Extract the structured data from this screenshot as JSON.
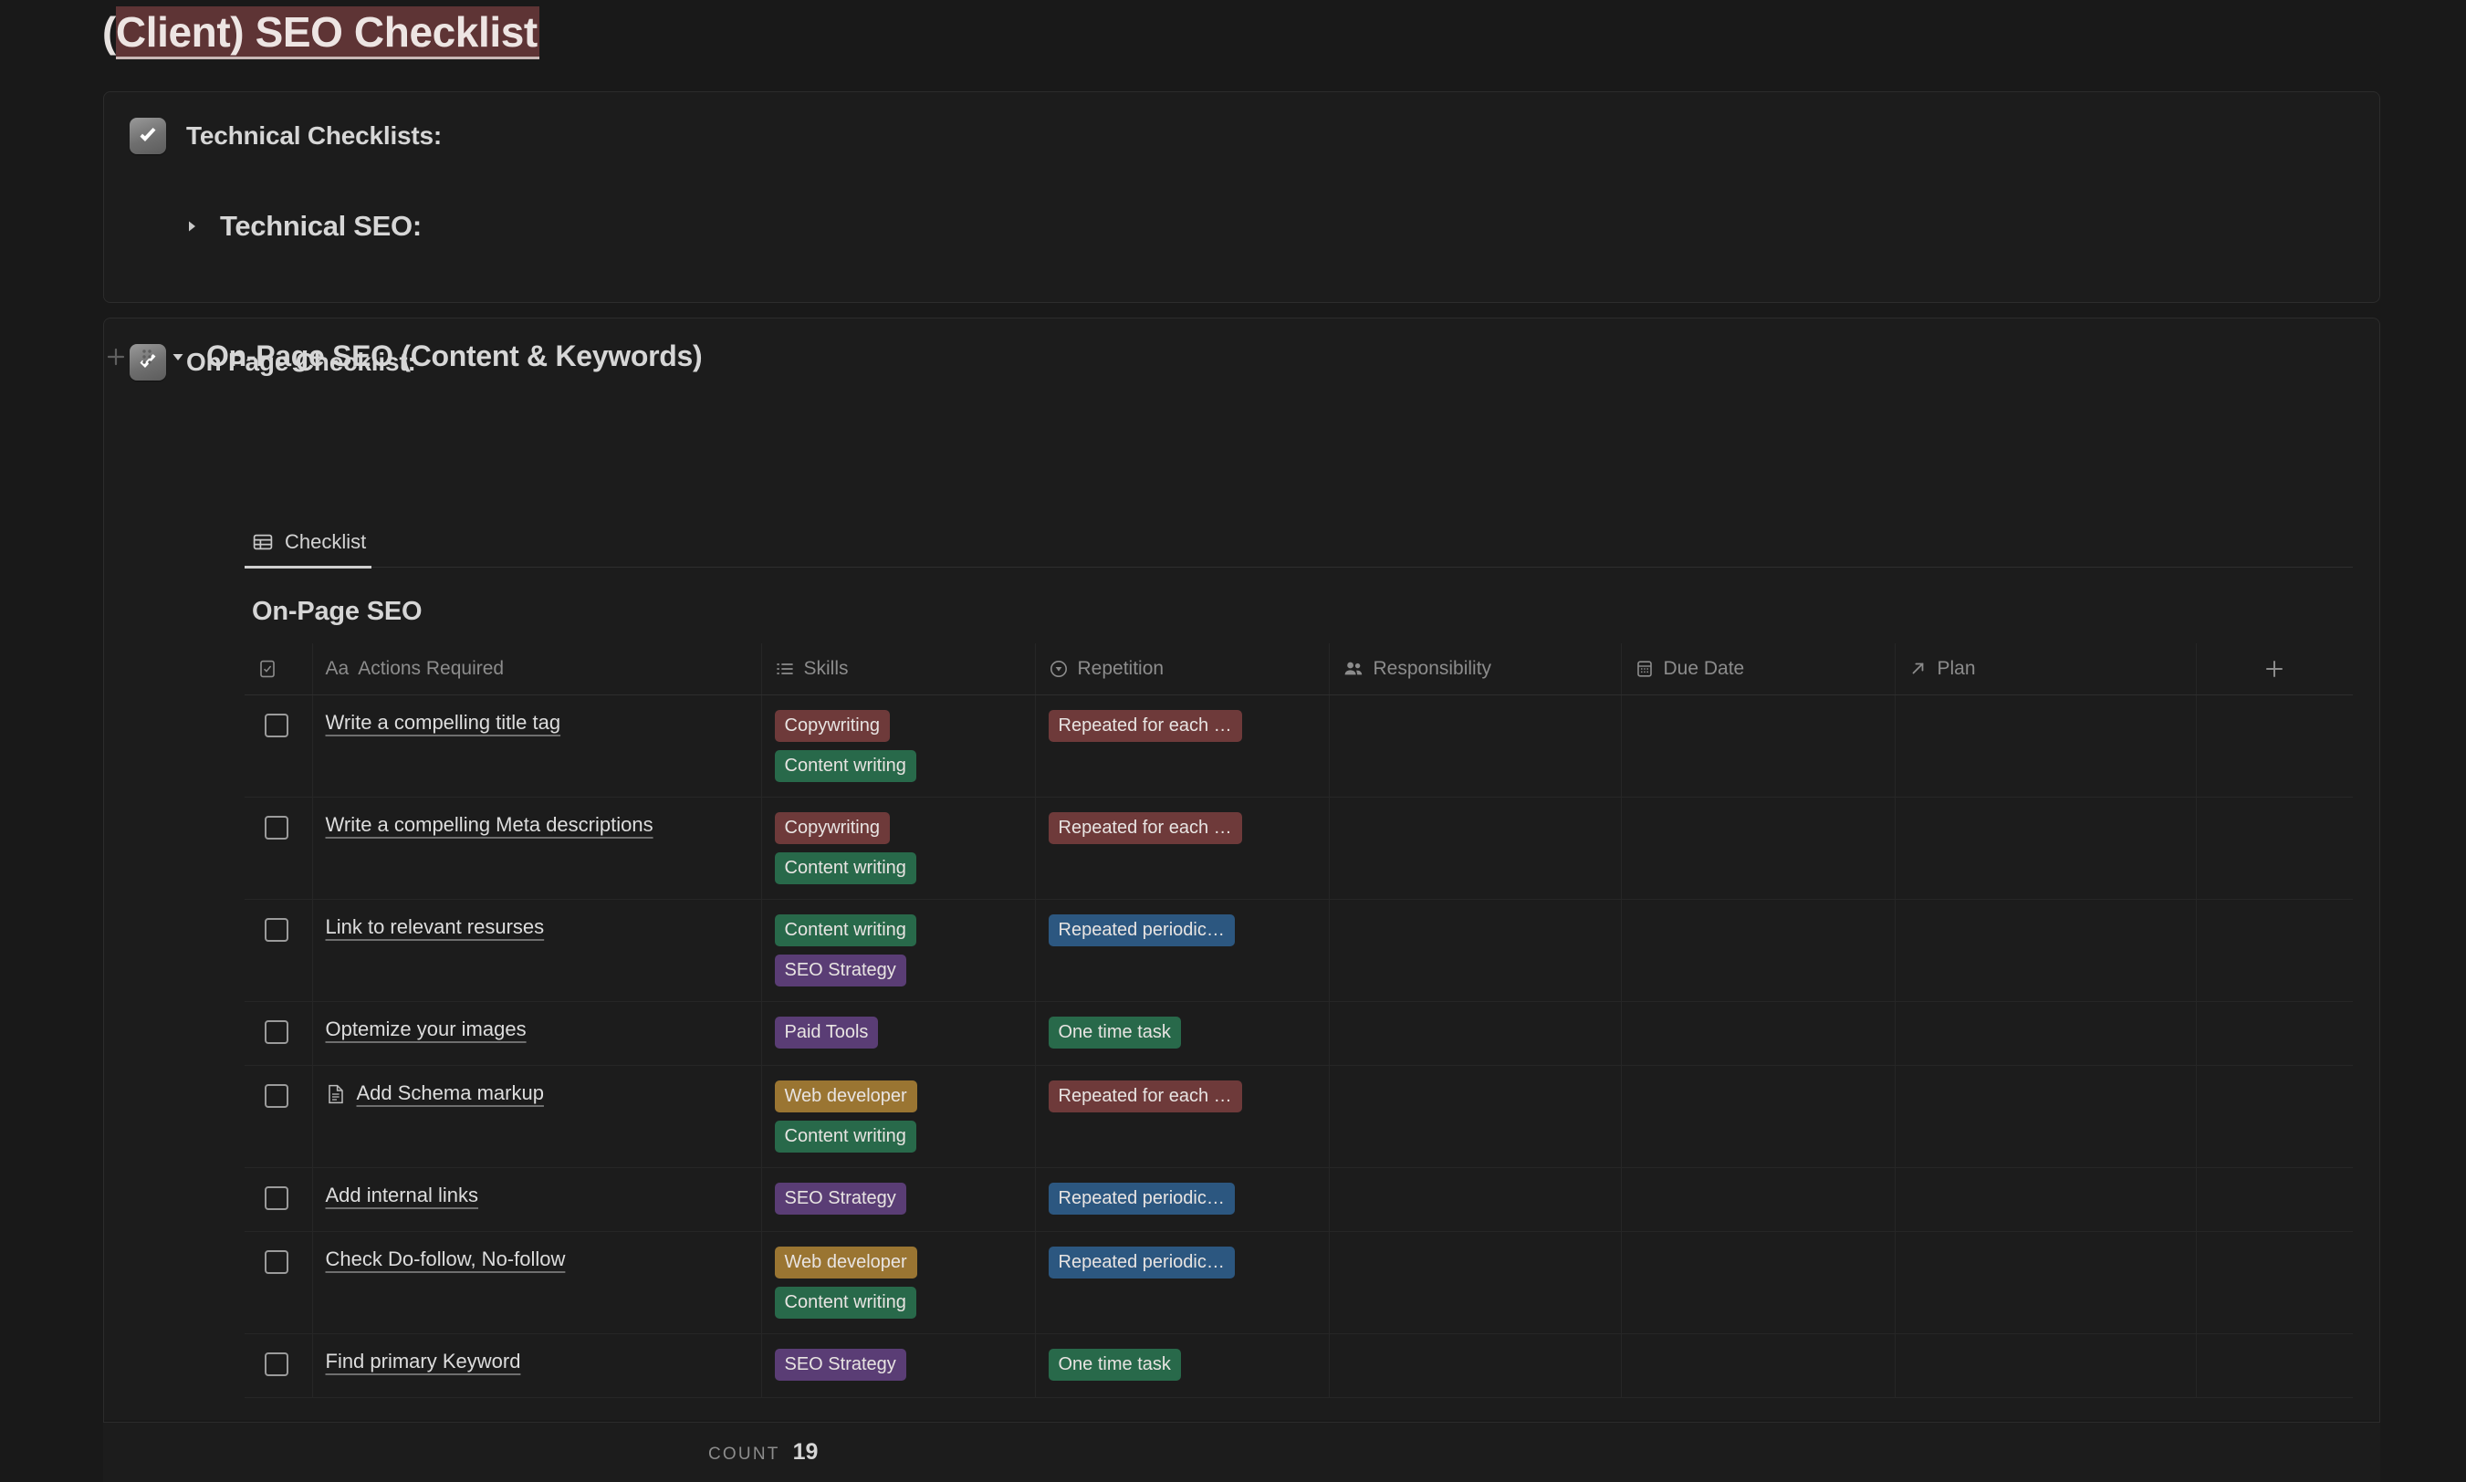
{
  "title": {
    "prefix": "(",
    "highlighted": "Client) SEO Checklist"
  },
  "callouts": [
    {
      "icon": "white-check-mark-emoji",
      "label": "Technical Checklists:",
      "toggle": {
        "state": "collapsed",
        "label": "Technical SEO:"
      }
    },
    {
      "icon": "white-check-mark-emoji",
      "label": "On Page Checklist:",
      "toggle": {
        "state": "expanded",
        "label": "On-Page SEO (Content & Keywords)"
      }
    }
  ],
  "gutter": {
    "add_block": "+",
    "drag_handle": "⁙"
  },
  "database": {
    "tabs": [
      {
        "icon": "table-icon",
        "label": "Checklist",
        "active": true
      }
    ],
    "title": "On-Page SEO",
    "add_column_label": "+",
    "columns": [
      {
        "icon": "checkbox-icon",
        "label": ""
      },
      {
        "icon": "title-aa-icon",
        "label": "Actions Required"
      },
      {
        "icon": "multi-select-icon",
        "label": "Skills"
      },
      {
        "icon": "select-icon",
        "label": "Repetition"
      },
      {
        "icon": "person-icon",
        "label": "Responsibility"
      },
      {
        "icon": "calendar-icon",
        "label": "Due Date"
      },
      {
        "icon": "relation-icon",
        "label": "Plan"
      }
    ],
    "rows": [
      {
        "checked": false,
        "icon": null,
        "name": "Write a compelling title tag",
        "skills": [
          {
            "label": "Copywriting",
            "color": "#6E3A3A"
          },
          {
            "label": "Content writing",
            "color": "#28694A"
          }
        ],
        "repetition": [
          {
            "label": "Repeated for each …",
            "color": "#6E3A3A"
          }
        ],
        "responsibility": "",
        "due_date": "",
        "plan": ""
      },
      {
        "checked": false,
        "icon": null,
        "name": "Write a compelling Meta descriptions",
        "skills": [
          {
            "label": "Copywriting",
            "color": "#6E3A3A"
          },
          {
            "label": "Content writing",
            "color": "#28694A"
          }
        ],
        "repetition": [
          {
            "label": "Repeated for each …",
            "color": "#6E3A3A"
          }
        ],
        "responsibility": "",
        "due_date": "",
        "plan": ""
      },
      {
        "checked": false,
        "icon": null,
        "name": "Link to relevant resurses",
        "skills": [
          {
            "label": "Content writing",
            "color": "#28694A"
          },
          {
            "label": "SEO Strategy",
            "color": "#5A3D75"
          }
        ],
        "repetition": [
          {
            "label": "Repeated periodic…",
            "color": "#2C5780"
          }
        ],
        "responsibility": "",
        "due_date": "",
        "plan": ""
      },
      {
        "checked": false,
        "icon": null,
        "name": "Optemize your images",
        "skills": [
          {
            "label": "Paid Tools",
            "color": "#5A3D75"
          }
        ],
        "repetition": [
          {
            "label": "One time task",
            "color": "#28694A"
          }
        ],
        "responsibility": "",
        "due_date": "",
        "plan": ""
      },
      {
        "checked": false,
        "icon": "page-icon",
        "name": "Add Schema markup",
        "skills": [
          {
            "label": "Web developer",
            "color": "#9A7532"
          },
          {
            "label": "Content writing",
            "color": "#28694A"
          }
        ],
        "repetition": [
          {
            "label": "Repeated for each …",
            "color": "#6E3A3A"
          }
        ],
        "responsibility": "",
        "due_date": "",
        "plan": ""
      },
      {
        "checked": false,
        "icon": null,
        "name": "Add internal links",
        "skills": [
          {
            "label": "SEO Strategy",
            "color": "#5A3D75"
          }
        ],
        "repetition": [
          {
            "label": "Repeated periodic…",
            "color": "#2C5780"
          }
        ],
        "responsibility": "",
        "due_date": "",
        "plan": ""
      },
      {
        "checked": false,
        "icon": null,
        "name": "Check Do-follow, No-follow",
        "skills": [
          {
            "label": "Web developer",
            "color": "#9A7532"
          },
          {
            "label": "Content writing",
            "color": "#28694A"
          }
        ],
        "repetition": [
          {
            "label": "Repeated periodic…",
            "color": "#2C5780"
          }
        ],
        "responsibility": "",
        "due_date": "",
        "plan": ""
      },
      {
        "checked": false,
        "icon": null,
        "name": "Find primary Keyword",
        "skills": [
          {
            "label": "SEO Strategy",
            "color": "#5A3D75"
          }
        ],
        "repetition": [
          {
            "label": "One time task",
            "color": "#28694A"
          }
        ],
        "responsibility": "",
        "due_date": "",
        "plan": ""
      }
    ],
    "footer": {
      "count_label": "Count",
      "count_value": "19"
    }
  }
}
